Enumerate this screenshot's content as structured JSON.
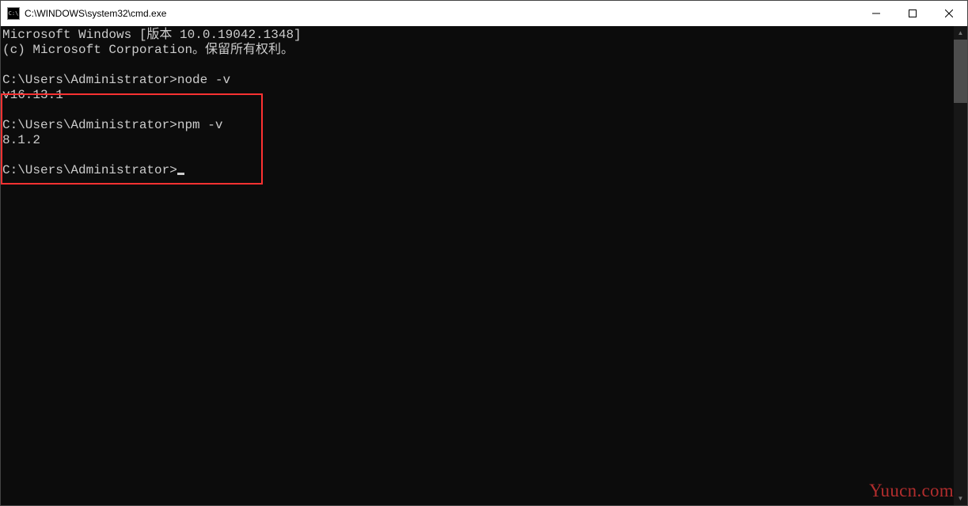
{
  "window": {
    "title": "C:\\WINDOWS\\system32\\cmd.exe"
  },
  "terminal": {
    "header_line1": "Microsoft Windows [版本 10.0.19042.1348]",
    "header_line2": "(c) Microsoft Corporation。保留所有权利。",
    "prompt": "C:\\Users\\Administrator>",
    "cmd1": "node -v",
    "out1": "v16.13.1",
    "cmd2": "npm -v",
    "out2": "8.1.2"
  },
  "watermark": "Yuucn.com"
}
